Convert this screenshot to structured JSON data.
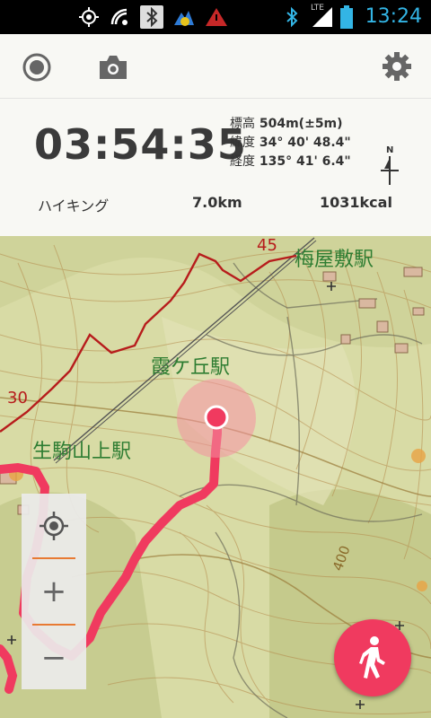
{
  "status_bar": {
    "time": "13:24",
    "network": "LTE",
    "icons": [
      "gps-icon",
      "sync-icon",
      "bluetooth-icon",
      "weather-app-icon",
      "warning-icon",
      "bluetooth-icon",
      "signal-icon",
      "battery-icon"
    ]
  },
  "toolbar": {
    "record_icon": "record-icon",
    "camera_icon": "camera-icon",
    "settings_icon": "gear-icon"
  },
  "tracking": {
    "elapsed_time": "03:54:35",
    "altitude_label": "標高",
    "altitude_value": "504m(±5m)",
    "latitude_label": "緯度",
    "latitude_value": "34° 40' 48.4\"",
    "longitude_label": "経度",
    "longitude_value": "135° 41' 6.4\"",
    "north_label": "N"
  },
  "stats": {
    "activity": "ハイキング",
    "distance": "7.0km",
    "calories": "1031kcal"
  },
  "map": {
    "labels": {
      "station_umeyashiki": "梅屋敷駅",
      "station_kasumigaoka": "霞ケ丘駅",
      "station_ikomasanjo": "生駒山上駅",
      "road_45": "45",
      "road_30": "30",
      "contour_400": "400"
    },
    "track_color": "#f03a5f",
    "road_color": "#c62828"
  },
  "zoom": {
    "locate_icon": "my-location-icon",
    "zoom_in": "+",
    "zoom_out": "−"
  },
  "fab": {
    "icon": "walking-person-icon"
  }
}
